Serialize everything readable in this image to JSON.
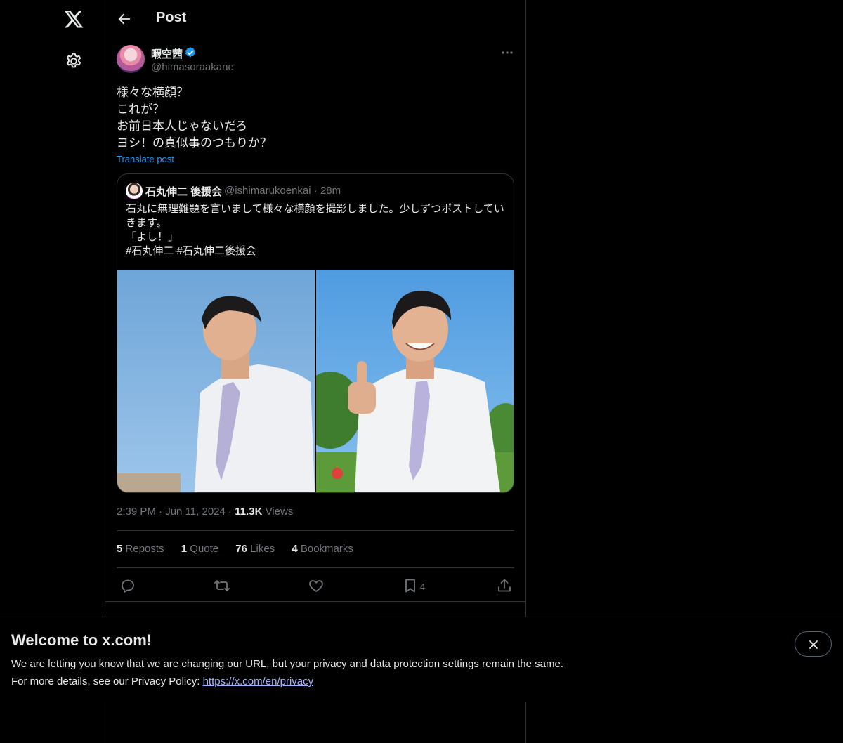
{
  "header": {
    "title": "Post"
  },
  "post": {
    "author_name": "暇空茜",
    "author_handle": "@himasoraakane",
    "lines": [
      "様々な横顔？",
      "これが？",
      "お前日本人じゃないだろ",
      "ヨシ！の真似事のつもりか？"
    ],
    "translate_label": "Translate post",
    "time": "2:39 PM",
    "date": "Jun 11, 2024",
    "views_count": "11.3K",
    "views_label": "Views"
  },
  "quote": {
    "author_name": "石丸伸二 後援会",
    "author_handle": "@ishimarukoenkai",
    "age": "28m",
    "lines": [
      "石丸に無理難題を言いまして様々な横顔を撮影しました。少しずつポストしてい",
      "きます。",
      "「よし！」",
      "#石丸伸二 #石丸伸二後援会"
    ]
  },
  "stats": {
    "reposts_count": "5",
    "reposts_label": "Reposts",
    "quotes_count": "1",
    "quotes_label": "Quote",
    "likes_count": "76",
    "likes_label": "Likes",
    "bookmarks_count": "4",
    "bookmarks_label": "Bookmarks"
  },
  "actions": {
    "bookmark_count": "4"
  },
  "banner": {
    "title": "Welcome to x.com!",
    "line1": "We are letting you know that we are changing our URL, but your privacy and data protection settings remain the same.",
    "line2_prefix": "For more details, see our Privacy Policy: ",
    "link_text": "https://x.com/en/privacy"
  },
  "colors": {
    "accent": "#1d9bf0",
    "link": "#a5b4fc",
    "border": "#2f3336",
    "muted": "#71767b"
  }
}
